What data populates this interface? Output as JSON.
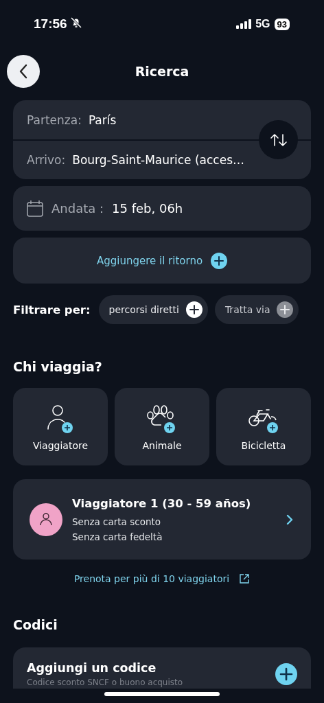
{
  "status_bar": {
    "time": "17:56",
    "silent": true,
    "network": "5G",
    "battery": "93"
  },
  "header": {
    "title": "Ricerca"
  },
  "route": {
    "departure_label": "Partenza:",
    "departure": "París",
    "arrival_label": "Arrivo:",
    "arrival": "Bourg-Saint-Maurice (acces…"
  },
  "outbound": {
    "label": "Andata :",
    "value": "15 feb, 06h"
  },
  "return_button": {
    "label": "Aggiungere il ritorno"
  },
  "filters": {
    "label": "Filtrare per:",
    "chips": [
      {
        "label": "percorsi diretti",
        "disabled": false
      },
      {
        "label": "Tratta via",
        "disabled": true
      }
    ]
  },
  "travellers_section": {
    "title": "Chi viaggia?",
    "tiles": [
      {
        "kind": "person",
        "label": "Viaggiatore"
      },
      {
        "kind": "pet",
        "label": "Animale"
      },
      {
        "kind": "bike",
        "label": "Bicicletta"
      }
    ]
  },
  "traveller": {
    "name": "Viaggiatore 1 (30 - 59 años)",
    "details": [
      "Senza carta sconto",
      "Senza carta fedeltà"
    ]
  },
  "group_link": "Prenota per più di 10 viaggiatori",
  "codes_section": {
    "title": "Codici",
    "card": {
      "title": "Aggiungi un codice",
      "subtitle": "Codice sconto SNCF o buono acquisto"
    }
  }
}
